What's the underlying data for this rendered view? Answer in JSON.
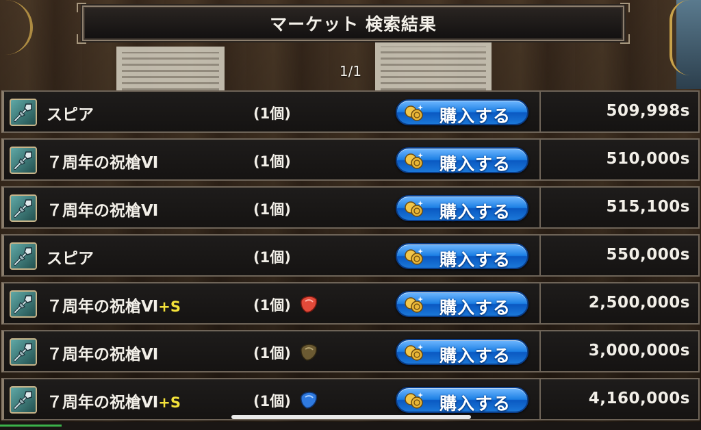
{
  "header": {
    "title": "マーケット 検索結果",
    "page_indicator": "1/1"
  },
  "buy_button_label": "購入する",
  "colors": {
    "button_blue": "#1c7fe4",
    "plus_yellow": "#f4e23a",
    "stone_red": "#e24a3a",
    "stone_brown": "#6b5a32",
    "stone_blue": "#2f7ae0"
  },
  "listings": [
    {
      "name": "スピア",
      "plus": "",
      "quantity": "(1個)",
      "stone": "",
      "price": "509,998s",
      "icon": "spear-icon"
    },
    {
      "name": "７周年の祝槍Ⅵ",
      "plus": "",
      "quantity": "(1個)",
      "stone": "",
      "price": "510,000s",
      "icon": "spear-icon"
    },
    {
      "name": "７周年の祝槍Ⅵ",
      "plus": "",
      "quantity": "(1個)",
      "stone": "",
      "price": "515,100s",
      "icon": "spear-icon"
    },
    {
      "name": "スピア",
      "plus": "",
      "quantity": "(1個)",
      "stone": "",
      "price": "550,000s",
      "icon": "spear-icon"
    },
    {
      "name": "７周年の祝槍Ⅵ",
      "plus": "+S",
      "quantity": "(1個)",
      "stone": "red-stone-icon",
      "price": "2,500,000s",
      "icon": "spear-icon"
    },
    {
      "name": "７周年の祝槍Ⅵ",
      "plus": "",
      "quantity": "(1個)",
      "stone": "brown-stone-icon",
      "price": "3,000,000s",
      "icon": "spear-icon"
    },
    {
      "name": "７周年の祝槍Ⅵ",
      "plus": "+S",
      "quantity": "(1個)",
      "stone": "blue-stone-icon",
      "price": "4,160,000s",
      "icon": "spear-icon"
    }
  ]
}
